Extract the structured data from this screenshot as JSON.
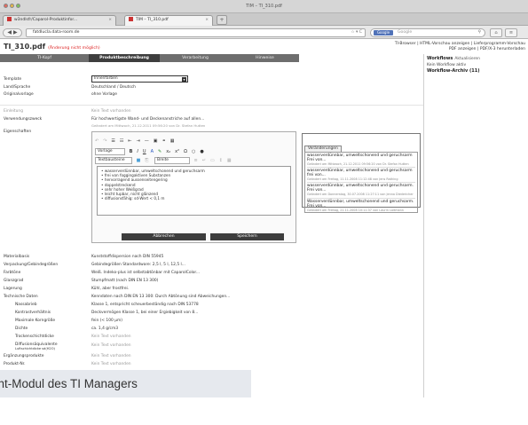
{
  "window": {
    "title": "TIM – TI_310.pdf"
  },
  "tabs": [
    {
      "label": "w3ndlsfr/Caparol-Produktinfor..."
    },
    {
      "label": "TIM – TI_310.pdf"
    }
  ],
  "newtab_label": "+",
  "url": {
    "value": "fatdlucla.data-room.de"
  },
  "search": {
    "engine": "Google",
    "placeholder": "Google"
  },
  "header": {
    "title": "TI_310.pdf",
    "warning": "(Änderung nicht möglich)",
    "links_line1": "TI-Browser | HTML-Vorschau anzeigen | Lieferprogramm-Vorschau",
    "links_line2": "PDF anzeigen | PDF/X-3 herunterladen"
  },
  "nav": [
    {
      "label": "TI-Kopf",
      "active": false
    },
    {
      "label": "Produktbeschreibung",
      "active": true
    },
    {
      "label": "Verarbeitung",
      "active": false
    },
    {
      "label": "Hinweise",
      "active": false
    }
  ],
  "sidebar": {
    "workflows_label": "Workflows",
    "update_label": "Aktualisieren",
    "no_workflow": "Kein Workflow aktiv",
    "archive": "Workflow-Archiv (11)"
  },
  "form_top": [
    {
      "label": "Template",
      "value": "Innenfarben"
    },
    {
      "label": "Land/Sprache",
      "value": "Deutschland / Deutsch"
    },
    {
      "label": "Originalvorlage",
      "value": "ohne Vorlage"
    }
  ],
  "form_mid": [
    {
      "label": "Einleitung",
      "value": "Kein Text vorhanden",
      "muted": true
    },
    {
      "label": "Verwendungszweck",
      "value": "Für hochwertigste Wand- und Deckenanstriche auf allen...",
      "note": "Geändert am Mittwoch, 21.12.2011 09:56:20 von Dr. Stefan Hutten"
    },
    {
      "label": "Eigenschaften",
      "value": ""
    }
  ],
  "editor": {
    "style_select": "Vorlage",
    "font_select": "Textbausteine",
    "format_select": "Breite",
    "lines": [
      "wasserverdünnbar, umweltschonend und geruchsarm",
      "frei von foggingaktiven Substanzen",
      "hervorragend aussenseitengering",
      "doppelstreckend",
      "sehr hoher Weißgrad",
      "leicht tupbar, nicht glänzend",
      "diffusionsfähig: sd-Wert < 0,1 m"
    ],
    "cancel_label": "Abbrechen",
    "save_label": "Speichern"
  },
  "revisions": {
    "tab_label": "Veränderungen",
    "items": [
      {
        "text": "wasserverdünnbar, umweltschonend und geruchsarm Frei von...",
        "meta": "Geändert am Mittwoch, 21.12.2011 09:56:20 von Dr. Stefan Hutten"
      },
      {
        "text": "wasserverdünnbar, umweltschonend und geruchsarm frei von...",
        "meta": "Geändert am Freitag, 11.11.2008 11:12:48 von Jens Rathing"
      },
      {
        "text": "wasserverdünnbar, umweltschonend und geruchsarm. Frei von...",
        "meta": "Geändert am Donnerstag, 30.07.2008 11:27:11 von Jenna Diedericher"
      },
      {
        "text": "Wasserverdünnbar, umweltschonend und geruchsarm. Frei von...",
        "meta": "Geändert am Freitag, 21.11.2008 10:11:37 von Laurin Laitmann"
      }
    ]
  },
  "specs": [
    {
      "label": "Materialbasis",
      "value": "Kunststoffdispersion nach DIN 55945"
    },
    {
      "label": "Verpackung/Gebindegrößen",
      "value": "Gebindegrößen Standardware: 2,5 l, 5 l, 12,5 l..."
    },
    {
      "label": "Farbtöne",
      "value": "Weiß. Indeko-plus ist selbstabtönbar mit CaparolColor..."
    },
    {
      "label": "Glanzgrad",
      "value": "Stumpfmatt (nach DIN EN 13 300)"
    },
    {
      "label": "Lagerung",
      "value": "Kühl, aber frostfrei."
    },
    {
      "label": "Technische Daten",
      "value": "Kenndaten nach DIN EN 13 300: Durch Abtönung sind Abweichungen..."
    },
    {
      "label": "Nassabrieb",
      "value": "Klasse 1, entspricht scheuerbeständig nach DIN 53778",
      "sub": true
    },
    {
      "label": "Kontrastverhältnis",
      "value": "Deckvermögen Klasse 1, bei einer Ergiebigkeit von 8...",
      "sub": true
    },
    {
      "label": "Maximale Korngröße",
      "value": "fein (< 100 µm)",
      "sub": true
    },
    {
      "label": "Dichte",
      "value": "ca. 1,4 g/cm3",
      "sub": true
    },
    {
      "label": "Trockenschichtdicke",
      "value": "Kein Text vorhanden",
      "sub": true,
      "muted": true
    },
    {
      "label": "Diffusionsäquivalente",
      "label2": "Luftschichtdicke sd(H2O)",
      "value": "Kein Text vorhanden",
      "sub": true,
      "muted": true
    },
    {
      "label": "Ergänzungsprodukte",
      "value": "Kein Text vorhanden",
      "muted": true
    },
    {
      "label": "Produkt-Nr.",
      "value": "Kein Text vorhanden",
      "muted": true
    },
    {
      "label": "Hinweis",
      "value": "Kein Text vorhanden",
      "muted": true
    }
  ],
  "caption": "rint-Modul des TI Managers",
  "colors": {
    "navbar": "#6e6e6e",
    "navbar_active": "#3e3e3e",
    "warning": "#dd2222",
    "caption_bg": "#e6e9ee",
    "button": "#3d3d3d"
  }
}
